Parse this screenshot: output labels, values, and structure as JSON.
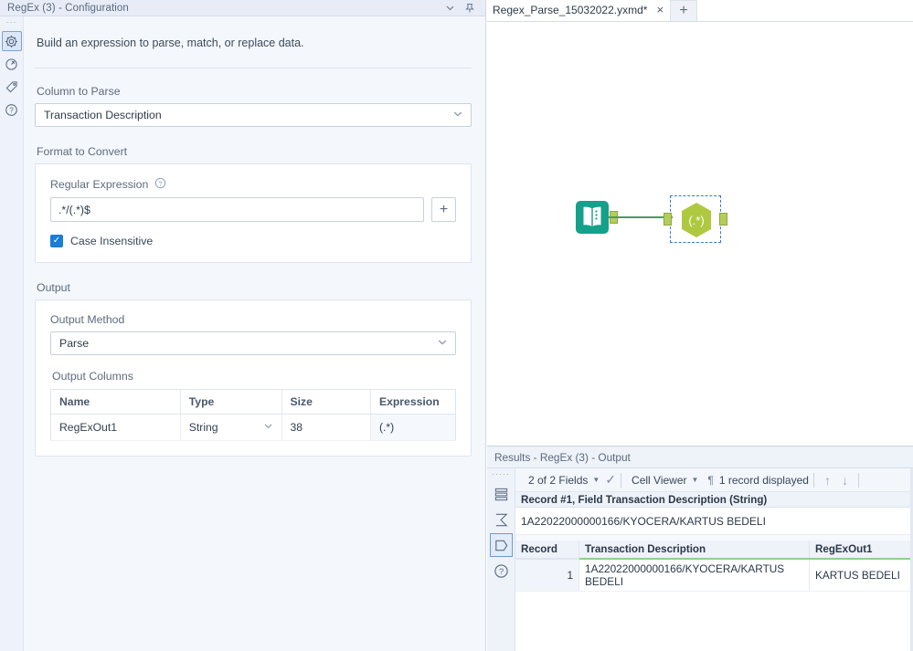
{
  "config_panel": {
    "title": "RegEx (3) - Configuration",
    "titlebar_icons": {
      "collapse": "chevron-down-icon",
      "pin": "pin-icon"
    },
    "rail": [
      {
        "name": "grip",
        "glyph": "···"
      },
      {
        "name": "configuration",
        "glyph": "gear-icon",
        "active": true
      },
      {
        "name": "annotation",
        "glyph": "target-icon",
        "active": false
      },
      {
        "name": "tag",
        "glyph": "tag-icon",
        "active": false
      },
      {
        "name": "help",
        "glyph": "question-icon",
        "active": false
      }
    ],
    "intro": "Build an expression to parse, match, or replace data.",
    "column_to_parse": {
      "label": "Column to Parse",
      "value": "Transaction Description"
    },
    "format_to_convert": {
      "label": "Format to Convert",
      "regex_label": "Regular Expression",
      "regex_value": ".*/(.*)$",
      "add_button": "+",
      "case_insensitive_label": "Case Insensitive",
      "case_insensitive_checked": true,
      "checkmark": "✓"
    },
    "output": {
      "label": "Output",
      "method_label": "Output Method",
      "method_value": "Parse",
      "columns_label": "Output Columns",
      "headers": [
        "Name",
        "Type",
        "Size",
        "Expression"
      ],
      "rows": [
        {
          "name": "RegExOut1",
          "type": "String",
          "size": "38",
          "expression": "(.*)"
        }
      ]
    }
  },
  "workflow": {
    "tab": {
      "label": "Regex_Parse_15032022.yxmd*",
      "close": "×",
      "add": "+"
    },
    "nodes": [
      {
        "name": "input-data-tool",
        "icon": "book-icon",
        "color": "#1aa389"
      },
      {
        "name": "regex-tool",
        "icon": "regex-hexagon-icon",
        "glyph": "(.*)",
        "color": "#aec93f",
        "selected": true
      }
    ]
  },
  "results": {
    "title": "Results - RegEx (3) - Output",
    "rail": [
      {
        "name": "grip",
        "glyph": "·····"
      },
      {
        "name": "data-rows",
        "glyph": "rows-icon",
        "active": false
      },
      {
        "name": "profile",
        "glyph": "sigma-icon",
        "active": false
      },
      {
        "name": "metadata",
        "glyph": "dshape-icon",
        "active": true
      },
      {
        "name": "help",
        "glyph": "question-icon",
        "active": false
      }
    ],
    "toolbar": {
      "fields": "2 of 2 Fields",
      "check": "✓",
      "viewer": "Cell Viewer",
      "pilcrow": "¶",
      "record_count": "1 record displayed",
      "up": "↑",
      "down": "↓"
    },
    "record_header": "Record #1, Field Transaction Description (String)",
    "record_value": "1A22022000000166/KYOCERA/KARTUS BEDELI",
    "grid": {
      "headers": [
        "Record",
        "Transaction Description",
        "RegExOut1"
      ],
      "rows": [
        {
          "record": "1",
          "transaction_description": "1A22022000000166/KYOCERA/KARTUS BEDELI",
          "regexout1": "KARTUS BEDELI"
        }
      ]
    }
  },
  "colors": {
    "panel_bg": "#f4f7fc",
    "accent_blue": "#1a7dd6",
    "input_tool": "#1aa389",
    "regex_tool": "#aec93f",
    "connector": "#4a9b5e",
    "grid_accent": "#8fcf8f"
  }
}
